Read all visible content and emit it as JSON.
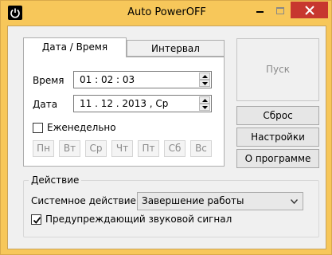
{
  "window": {
    "title": "Auto PowerOFF"
  },
  "tabs": [
    {
      "label": "Дата / Время"
    },
    {
      "label": "Интервал"
    }
  ],
  "datetime": {
    "time_label": "Время",
    "time_value": "01 : 02 : 03",
    "date_label": "Дата",
    "date_value": "11 . 12 . 2013 , Ср",
    "weekly_label": "Еженедельно",
    "weekly_checked": false,
    "days": [
      "Пн",
      "Вт",
      "Ср",
      "Чт",
      "Пт",
      "Сб",
      "Вс"
    ]
  },
  "buttons": {
    "start": "Пуск",
    "reset": "Сброс",
    "settings": "Настройки",
    "about": "О программе"
  },
  "action": {
    "group_title": "Действие",
    "system_action_label": "Системное действие",
    "system_action_value": "Завершение работы",
    "warning_sound_label": "Предупреждающий звуковой сигнал",
    "warning_sound_checked": true
  },
  "colors": {
    "frame": "#f7c75a",
    "close_button": "#c7372f",
    "client_bg": "#f0f0f0"
  },
  "icons": [
    "power-icon",
    "minimize-icon",
    "maximize-icon",
    "close-icon",
    "spin-up-icon",
    "spin-down-icon",
    "dropdown-arrow-icon",
    "checkmark-icon"
  ]
}
